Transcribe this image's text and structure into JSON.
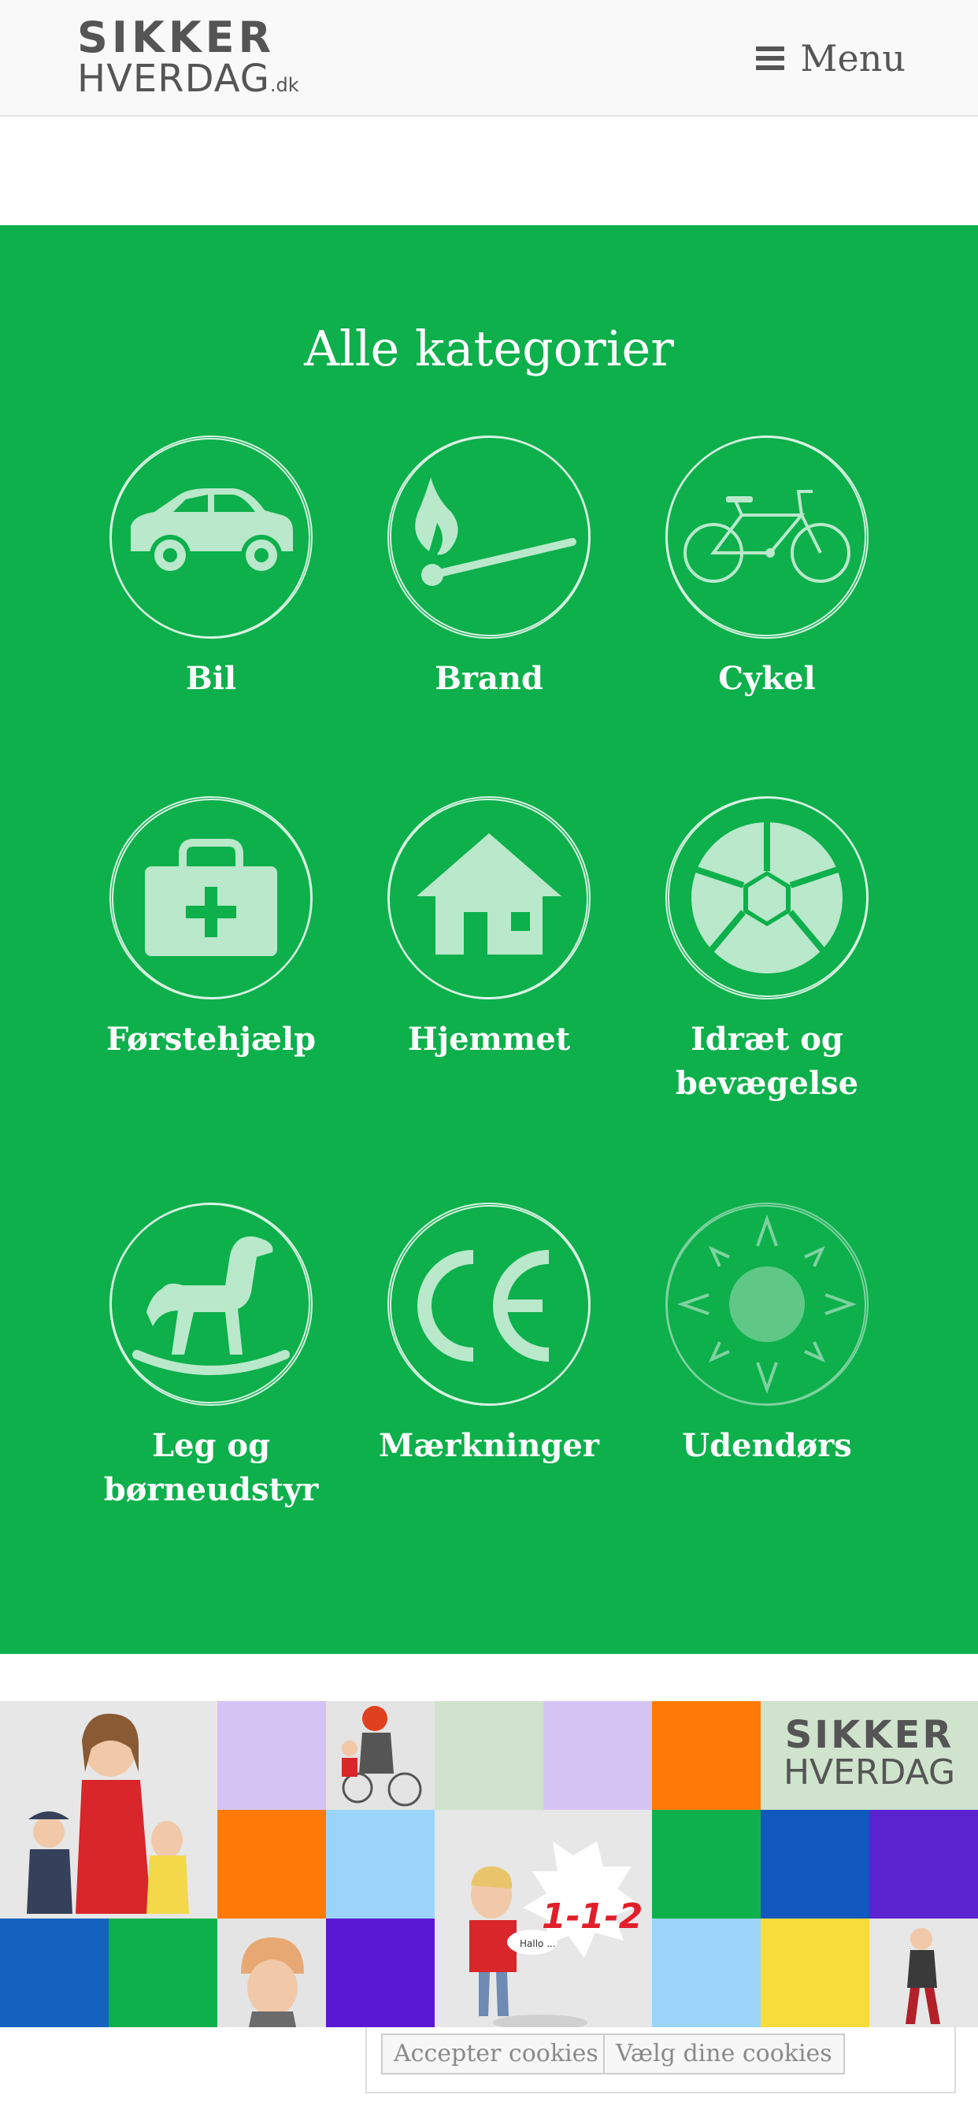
{
  "header": {
    "logo_top": "SIKKER",
    "logo_bottom": "HVERDAG",
    "logo_suffix": ".dk",
    "menu_label": "Menu"
  },
  "categories": {
    "title": "Alle kategorier",
    "items": [
      {
        "label": "Bil",
        "icon": "car-icon"
      },
      {
        "label": "Brand",
        "icon": "match-fire-icon"
      },
      {
        "label": "Cykel",
        "icon": "bicycle-icon"
      },
      {
        "label": "Førstehjælp",
        "icon": "first-aid-kit-icon"
      },
      {
        "label": "Hjemmet",
        "icon": "house-icon"
      },
      {
        "label": "Idræt og bevægelse",
        "icon": "football-icon"
      },
      {
        "label": "Leg og børneudstyr",
        "icon": "rocking-horse-icon"
      },
      {
        "label": "Mærkninger",
        "icon": "ce-mark-icon"
      },
      {
        "label": "Udendørs",
        "icon": "sun-icon"
      }
    ]
  },
  "banner": {
    "logo_top": "SIKKER",
    "logo_bottom": "HVERDAG",
    "emergency_number": "1-1-2",
    "speech_text": "Hallo ..."
  },
  "cookies": {
    "accept_label": "Accepter cookies",
    "choose_label": "Vælg dine cookies"
  },
  "colors": {
    "brand_green": "#0db04b",
    "icon_fill": "#b9e8cb",
    "header_bg": "#f9f9f9",
    "logo_gray": "#555555"
  }
}
